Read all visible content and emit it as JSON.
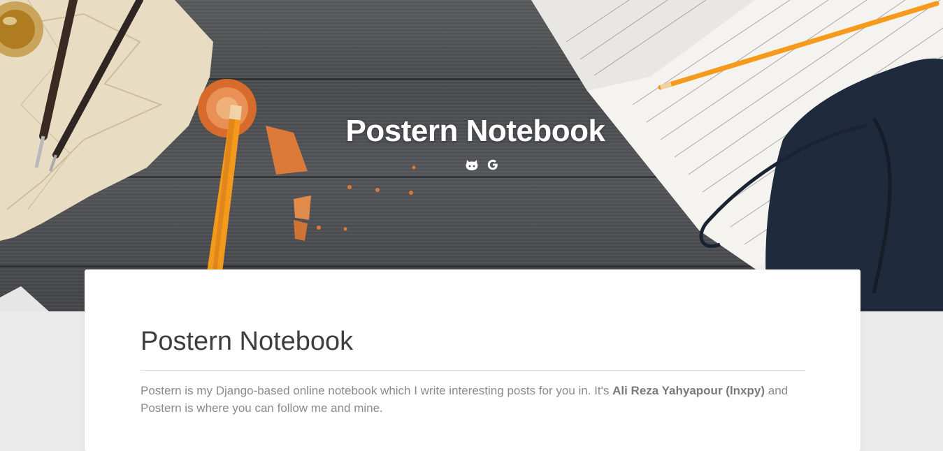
{
  "hero": {
    "title": "Postern Notebook",
    "links": [
      {
        "icon": "github-icon",
        "label": "GitHub"
      },
      {
        "icon": "google-icon",
        "label": "G"
      }
    ]
  },
  "card": {
    "title": "Postern Notebook",
    "text_before": "Postern is my Django-based online notebook which I write interesting posts for you in. It's ",
    "author": "Ali Reza Yahyapour (lnxpy)",
    "text_after": " and Postern is where you can follow me and mine."
  },
  "colors": {
    "hero_wood": "#4f5053",
    "page_background": "#ebebeb",
    "card_background": "#ffffff",
    "title_text": "#3e3e3e",
    "body_text": "#8a8a8a",
    "pencil_orange": "#f39a1c",
    "leather_navy": "#1f2a3c"
  }
}
